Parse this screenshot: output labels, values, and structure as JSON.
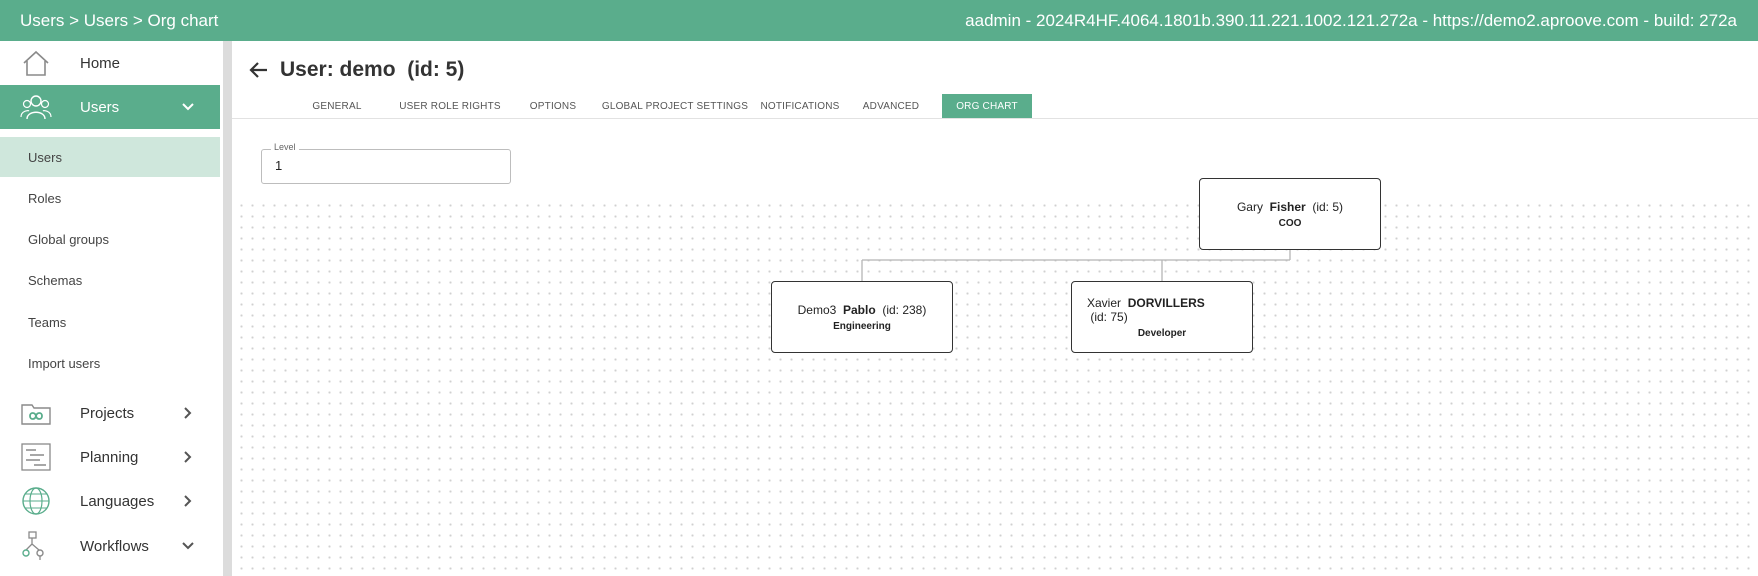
{
  "topbar": {
    "breadcrumb": "Users > Users > Org chart",
    "info": "aadmin - 2024R4HF.4064.1801b.390.11.221.1002.121.272a - https://demo2.aproove.com - build: 272a"
  },
  "sidebar": {
    "items": [
      {
        "label": "Home",
        "icon": "home-icon"
      },
      {
        "label": "Users",
        "icon": "users-icon"
      },
      {
        "label": "Projects",
        "icon": "infinity-folder-icon"
      },
      {
        "label": "Planning",
        "icon": "gantt-icon"
      },
      {
        "label": "Languages",
        "icon": "globe-icon"
      },
      {
        "label": "Workflows",
        "icon": "workflow-icon"
      }
    ],
    "sub_items": [
      "Users",
      "Roles",
      "Global groups",
      "Schemas",
      "Teams",
      "Import users"
    ]
  },
  "page": {
    "title": "User: demo  (id: 5)"
  },
  "tabs": [
    "GENERAL",
    "USER ROLE RIGHTS",
    "OPTIONS",
    "GLOBAL PROJECT SETTINGS",
    "NOTIFICATIONS",
    "ADVANCED",
    "ORG CHART"
  ],
  "active_tab": "ORG CHART",
  "level": {
    "label": "Level",
    "value": "1"
  },
  "org_chart": {
    "root": {
      "first": "Gary",
      "last": "Fisher",
      "id": "(id: 5)",
      "role": "COO"
    },
    "children": [
      {
        "first": "Demo3",
        "last": "Pablo",
        "id": "(id: 238)",
        "role": "Engineering"
      },
      {
        "first": "Xavier",
        "last": "DORVILLERS",
        "id": "(id: 75)",
        "role": "Developer"
      }
    ]
  },
  "colors": {
    "accent": "#5aad8c",
    "selected_bg": "#cfe7dc"
  }
}
